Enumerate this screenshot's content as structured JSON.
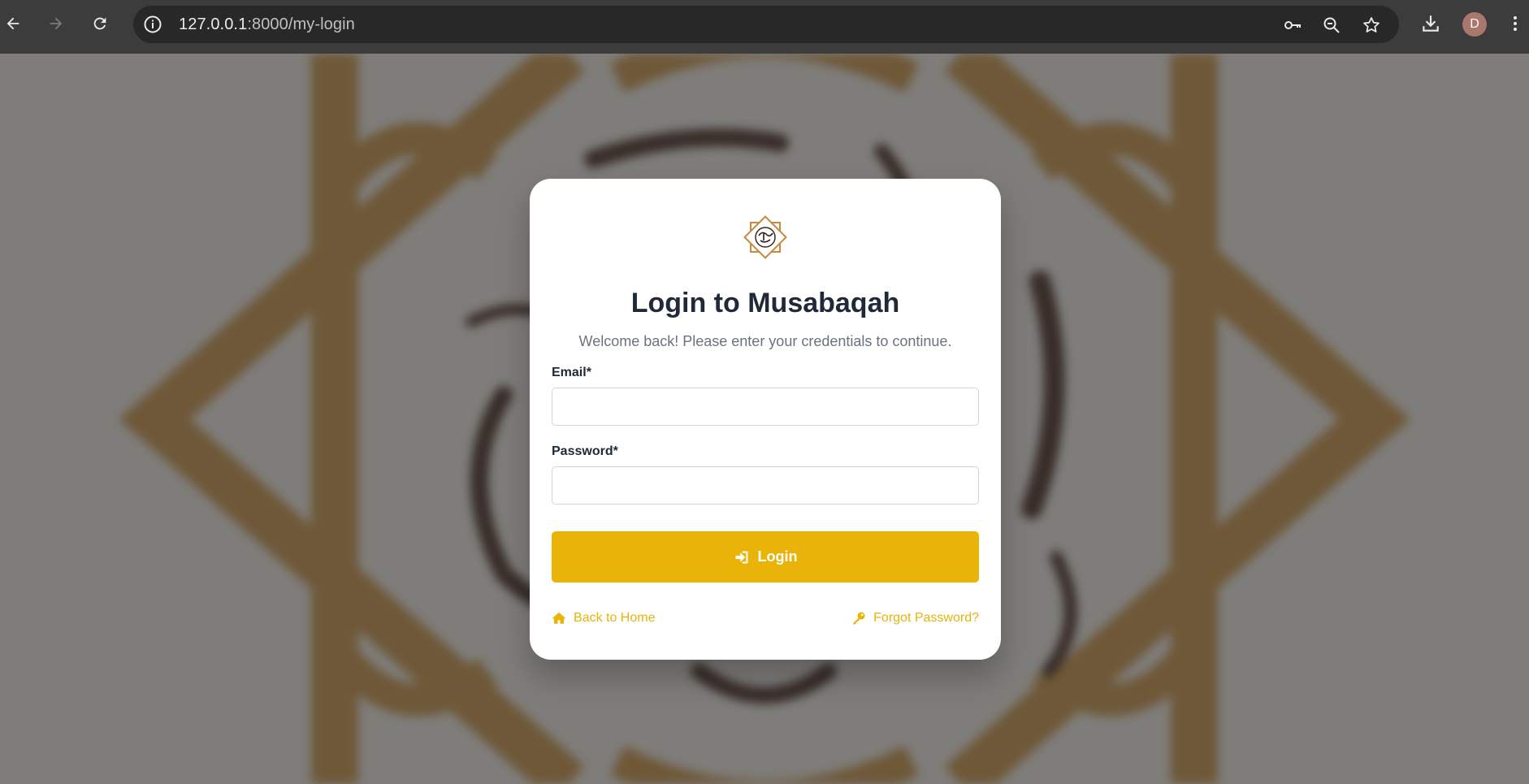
{
  "browser": {
    "url_host": "127.0.0.1",
    "url_path": ":8000/my-login",
    "profile_initial": "D"
  },
  "icons": {
    "back": "arrow-left-icon",
    "forward": "arrow-right-icon",
    "reload": "reload-icon",
    "site_info": "info-icon",
    "password_key": "key-icon",
    "zoom": "zoom-out-icon",
    "bookmark": "star-icon",
    "download": "download-icon",
    "menu": "kebab-menu-icon",
    "login": "sign-in-icon",
    "home": "home-icon",
    "forgot": "key-icon"
  },
  "colors": {
    "accent": "#eab308",
    "title": "#1f2937",
    "muted": "#6b7280",
    "logo": "#c8893e"
  },
  "login": {
    "title": "Login to Musabaqah",
    "subtitle": "Welcome back! Please enter your credentials to continue.",
    "email_label": "Email*",
    "email_value": "",
    "password_label": "Password*",
    "password_value": "",
    "submit_label": "Login",
    "back_home_label": "Back to Home",
    "forgot_label": "Forgot Password?"
  }
}
